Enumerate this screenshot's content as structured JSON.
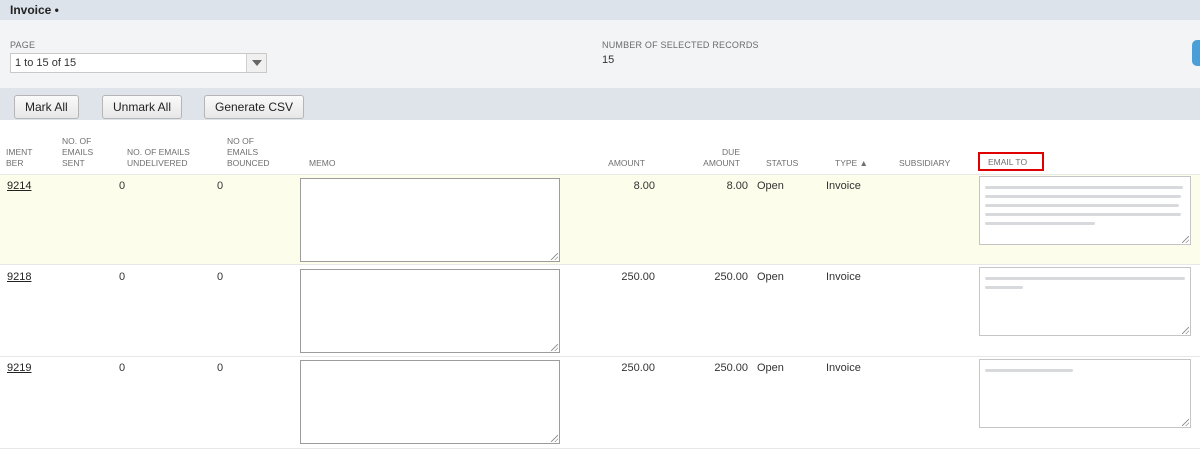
{
  "window": {
    "title": "Invoice •"
  },
  "criteria": {
    "page_label": "PAGE",
    "page_value": "1 to 15 of 15",
    "selected_label": "NUMBER OF SELECTED RECORDS",
    "selected_value": "15"
  },
  "toolbar": {
    "mark_all": "Mark All",
    "unmark_all": "Unmark All",
    "generate_csv": "Generate CSV"
  },
  "table": {
    "headers": {
      "document_number": [
        "IMENT",
        "BER"
      ],
      "emails_sent": [
        "NO. OF",
        "EMAILS",
        "SENT"
      ],
      "emails_undelivered": [
        "NO. OF EMAILS",
        "UNDELIVERED"
      ],
      "emails_bounced": [
        "NO OF",
        "EMAILS",
        "BOUNCED"
      ],
      "memo": "MEMO",
      "amount": "AMOUNT",
      "amount_due": [
        "DUE",
        "AMOUNT"
      ],
      "status": "STATUS",
      "type": "TYPE ▲",
      "subsidiary": "SUBSIDIARY",
      "email_to": "EMAIL TO"
    },
    "rows": [
      {
        "doc": "9214",
        "sent": "0",
        "bounced": "0",
        "amount": "8.00",
        "due": "8.00",
        "status": "Open",
        "type": "Invoice",
        "highlighted": true
      },
      {
        "doc": "9218",
        "sent": "0",
        "bounced": "0",
        "amount": "250.00",
        "due": "250.00",
        "status": "Open",
        "type": "Invoice",
        "highlighted": false
      },
      {
        "doc": "9219",
        "sent": "0",
        "bounced": "0",
        "amount": "250.00",
        "due": "250.00",
        "status": "Open",
        "type": "Invoice",
        "highlighted": false
      }
    ]
  }
}
